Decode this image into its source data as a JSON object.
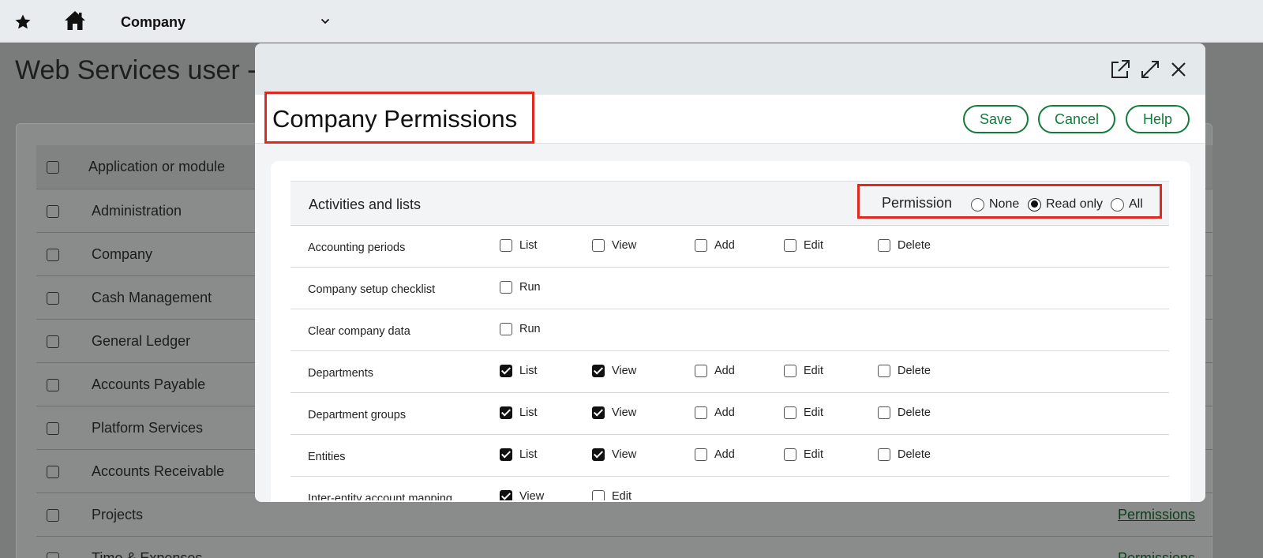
{
  "topbar": {
    "favorites_icon": "star-icon",
    "home_icon": "home-icon",
    "company_label": "Company",
    "dropdown_icon": "chevron-down-icon"
  },
  "background": {
    "page_title": "Web Services user -",
    "table_header": "Application or module",
    "rows": [
      "Administration",
      "Company",
      "Cash Management",
      "General Ledger",
      "Accounts Payable",
      "Platform Services",
      "Accounts Receivable",
      "Projects",
      "Time & Expenses"
    ],
    "link_label": "Permissions"
  },
  "modal": {
    "icons": [
      "open-in-new-window-icon",
      "expand-icon",
      "close-icon"
    ],
    "title": "Company Permissions",
    "buttons": {
      "save": "Save",
      "cancel": "Cancel",
      "help": "Help"
    },
    "section_title": "Activities and lists",
    "permission": {
      "label": "Permission",
      "options": [
        "None",
        "Read only",
        "All"
      ],
      "selected": "Read only"
    },
    "rows": [
      {
        "name": "Accounting periods",
        "perms": [
          {
            "label": "List",
            "checked": false
          },
          {
            "label": "View",
            "checked": false
          },
          {
            "label": "Add",
            "checked": false
          },
          {
            "label": "Edit",
            "checked": false
          },
          {
            "label": "Delete",
            "checked": false
          }
        ]
      },
      {
        "name": "Company setup checklist",
        "perms": [
          {
            "label": "Run",
            "checked": false
          }
        ]
      },
      {
        "name": "Clear company data",
        "perms": [
          {
            "label": "Run",
            "checked": false
          }
        ]
      },
      {
        "name": "Departments",
        "perms": [
          {
            "label": "List",
            "checked": true
          },
          {
            "label": "View",
            "checked": true
          },
          {
            "label": "Add",
            "checked": false
          },
          {
            "label": "Edit",
            "checked": false
          },
          {
            "label": "Delete",
            "checked": false
          }
        ]
      },
      {
        "name": "Department groups",
        "perms": [
          {
            "label": "List",
            "checked": true
          },
          {
            "label": "View",
            "checked": true
          },
          {
            "label": "Add",
            "checked": false
          },
          {
            "label": "Edit",
            "checked": false
          },
          {
            "label": "Delete",
            "checked": false
          }
        ]
      },
      {
        "name": "Entities",
        "perms": [
          {
            "label": "List",
            "checked": true
          },
          {
            "label": "View",
            "checked": true
          },
          {
            "label": "Add",
            "checked": false
          },
          {
            "label": "Edit",
            "checked": false
          },
          {
            "label": "Delete",
            "checked": false
          }
        ]
      },
      {
        "name": "Inter-entity account mapping",
        "perms": [
          {
            "label": "View",
            "checked": true
          },
          {
            "label": "Edit",
            "checked": false
          }
        ]
      }
    ]
  },
  "colors": {
    "accent": "#127a3a",
    "highlight": "#e0291f",
    "overlay": "#7a7c7b"
  }
}
